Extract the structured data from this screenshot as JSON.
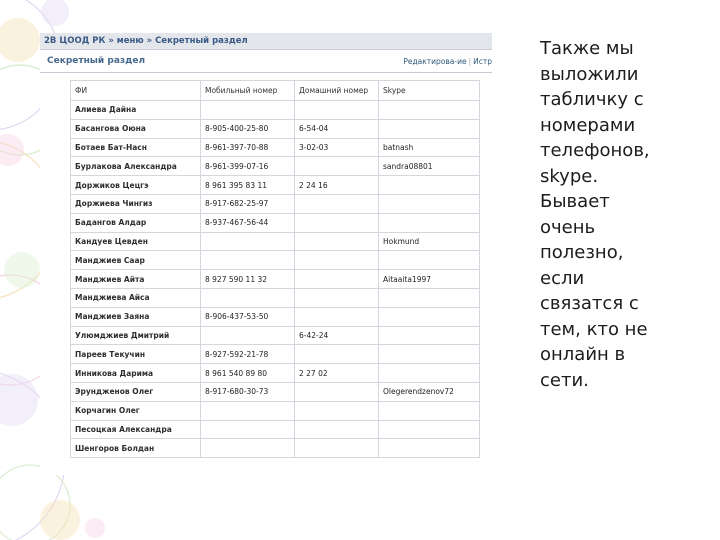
{
  "breadcrumb": "2В ЦООД РК » меню » Секретный раздел",
  "section_title": "Секретный раздел",
  "links": {
    "edit": "Редактирова-ие",
    "other": "Истр"
  },
  "table": {
    "headers": [
      "ФИ",
      "Мобильный номер",
      "Домашний номер",
      "Skype"
    ],
    "rows": [
      [
        "Алиева Дайна",
        "",
        "",
        ""
      ],
      [
        "Басангова Оюна",
        "8-905-400-25-80",
        "6-54-04",
        ""
      ],
      [
        "Ботаев Бат-Насн",
        "8-961-397-70-88",
        "3-02-03",
        "batnash"
      ],
      [
        "Бурлакова Александра",
        "8-961-399-07-16",
        "",
        "sandra08801"
      ],
      [
        "Доржиков Цецгэ",
        "8 961 395 83 11",
        "2 24 16",
        ""
      ],
      [
        "Доржиева Чингиз",
        "8-917-682-25-97",
        "",
        ""
      ],
      [
        "Бадангов Алдар",
        "8-937-467-56-44",
        "",
        ""
      ],
      [
        "Кандуев Цевден",
        "",
        "",
        "Hokmund"
      ],
      [
        "Манджиев Саар",
        "",
        "",
        ""
      ],
      [
        "Манджиев Айта",
        "8 927 590 11 32",
        "",
        "Aitaaita1997"
      ],
      [
        "Манджиева Айса",
        "",
        "",
        ""
      ],
      [
        "Манджиев Заяна",
        "8-906-437-53-50",
        "",
        ""
      ],
      [
        "Улюмджиев Дмитрий",
        "",
        "6-42-24",
        ""
      ],
      [
        "Пареев Текучин",
        "8-927-592-21-78",
        "",
        ""
      ],
      [
        "Инникова Дарима",
        "8 961 540 89 80",
        "2 27 02",
        ""
      ],
      [
        "Эрундженов Олег",
        "8-917-680-30-73",
        "",
        "Olegerendzenov72"
      ],
      [
        "Корчагин Олег",
        "",
        "",
        ""
      ],
      [
        "Песоцкая Александра",
        "",
        "",
        ""
      ],
      [
        "Шенгоров Болдан",
        "",
        "",
        ""
      ]
    ]
  },
  "caption": "Также мы\nвыложили\nтабличку с\nномерами\nтелефонов,\nskype.\nБывает\nочень\nполезно,\nесли\nсвязатся с\nтем, кто не\nонлайн в\nсети."
}
